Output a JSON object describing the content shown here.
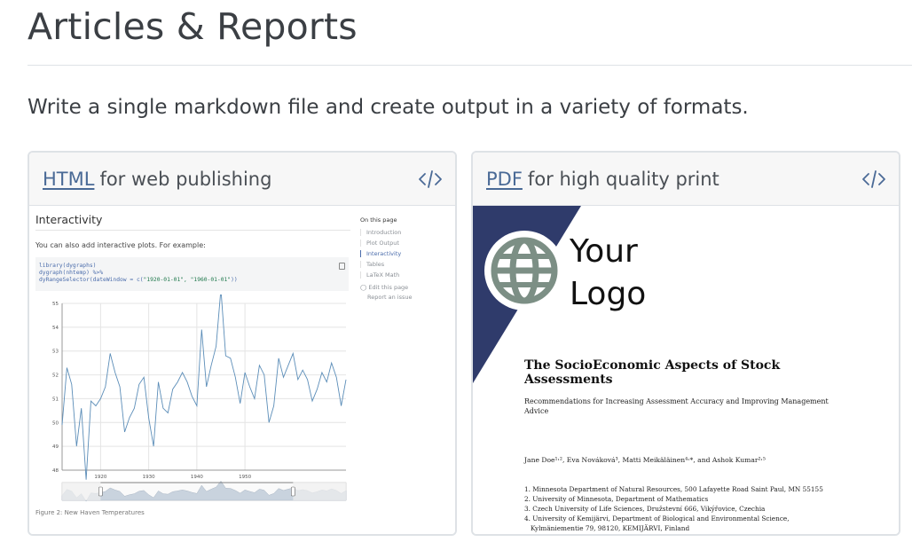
{
  "page": {
    "title": "Articles & Reports",
    "lead": "Write a single markdown file and create output in a variety of formats."
  },
  "cards": [
    {
      "format_link": "HTML",
      "description": "for web publishing",
      "code_icon": "code-icon",
      "preview": {
        "heading": "Interactivity",
        "text": "You can also add interactive plots. For example:",
        "code_lines": [
          "library(dygraphs)",
          "dygraph(nhtemp) %>%",
          "  dyRangeSelector(dateWindow = c(",
          "\"1920-01-01\", \"1960-01-01\"",
          "))"
        ],
        "toc": {
          "heading": "On this page",
          "items": [
            "Introduction",
            "Plot Output",
            "Interactivity",
            "Tables",
            "LaTeX Math"
          ],
          "active_index": 2,
          "links": [
            "Edit this page",
            "Report an issue"
          ]
        },
        "caption": "Figure 2: New Haven Temperatures"
      }
    },
    {
      "format_link": "PDF",
      "description": "for high quality print",
      "code_icon": "code-icon",
      "preview": {
        "logo_line1": "Your",
        "logo_line2": "Logo",
        "doc_title": "The SocioEconomic Aspects of Stock Assessments",
        "doc_subtitle": "Recommendations for Increasing Assessment Accuracy and Improving Management Advice",
        "authors": "Jane Doe¹˒², Eva Nováková³, Matti Meikäläinen⁴˒*, and Ashok Kumar²˒⁵",
        "affiliations": [
          "1. Minnesota Department of Natural Resources, 500 Lafayette Road Saint Paul, MN 55155",
          "2. University of Minnesota, Department of Mathematics",
          "3. Czech University of Life Sciences, Družstevní 666, Vikýřovice, Czechia",
          "4. University of Kemijärvi, Department of Biological and Environmental Science,",
          "   Kylmäniementie 79, 98120, KEMIJÄRVI, Finland"
        ]
      }
    }
  ],
  "colors": {
    "link": "#4a6a96",
    "header_bg": "#f7f7f7",
    "border": "#dee2e6",
    "logo_banner": "#2f3b6b",
    "globe": "#7c8f85",
    "series": "#5b8db8"
  },
  "chart_data": {
    "type": "line",
    "x_ticks": [
      "1920",
      "1930",
      "1940",
      "1950"
    ],
    "y_ticks": [
      "48",
      "49",
      "50",
      "51",
      "52",
      "53",
      "54",
      "55"
    ],
    "x": [
      1912,
      1913,
      1914,
      1915,
      1916,
      1917,
      1918,
      1919,
      1920,
      1921,
      1922,
      1923,
      1924,
      1925,
      1926,
      1927,
      1928,
      1929,
      1930,
      1931,
      1932,
      1933,
      1934,
      1935,
      1936,
      1937,
      1938,
      1939,
      1940,
      1941,
      1942,
      1943,
      1944,
      1945,
      1946,
      1947,
      1948,
      1949,
      1950,
      1951,
      1952,
      1953,
      1954,
      1955,
      1956,
      1957,
      1958,
      1959,
      1960,
      1961,
      1962,
      1963,
      1964,
      1965,
      1966,
      1967,
      1968,
      1969,
      1970,
      1971
    ],
    "series": [
      {
        "values": [
          49.9,
          52.3,
          51.6,
          49.0,
          50.6,
          47.6,
          50.9,
          50.7,
          51.0,
          51.5,
          52.9,
          52.1,
          51.5,
          49.6,
          50.2,
          50.6,
          51.6,
          51.9,
          50.2,
          49.0,
          51.7,
          50.6,
          50.4,
          51.4,
          51.7,
          52.1,
          51.7,
          51.1,
          50.7,
          53.9,
          51.5,
          52.4,
          53.2,
          55.6,
          52.8,
          52.7,
          51.9,
          50.8,
          52.1,
          51.5,
          51.0,
          52.4,
          52.0,
          50.0,
          50.7,
          52.7,
          51.9,
          52.4,
          52.9,
          51.8,
          52.2,
          51.8,
          50.9,
          51.4,
          52.1,
          51.7,
          52.5,
          51.9,
          50.7,
          51.8
        ]
      }
    ],
    "ylim": [
      48,
      55
    ],
    "xlim": [
      1912,
      1971
    ],
    "grid": true,
    "range_selector": true
  }
}
